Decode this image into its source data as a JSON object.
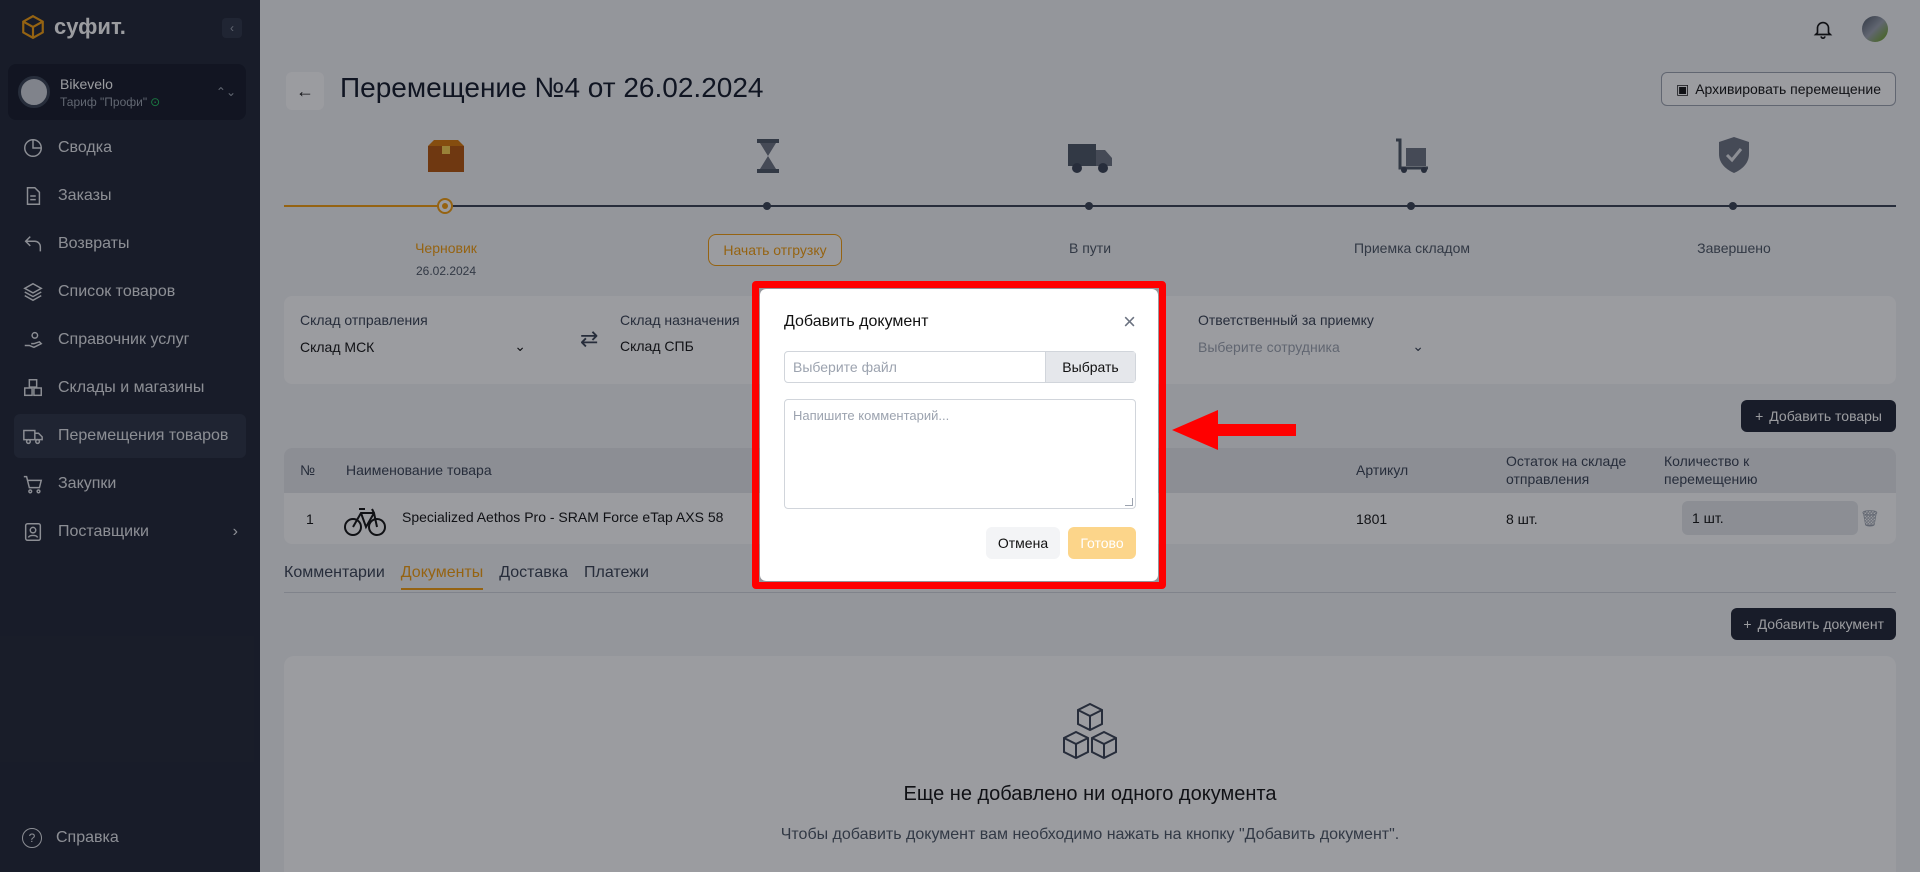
{
  "brand": {
    "name": "суфит."
  },
  "company": {
    "name": "Bikevelo",
    "tariff": "Тариф \"Профи\""
  },
  "nav": {
    "items": [
      {
        "label": "Сводка",
        "icon": "pie-chart-icon"
      },
      {
        "label": "Заказы",
        "icon": "document-icon"
      },
      {
        "label": "Возвраты",
        "icon": "return-icon"
      },
      {
        "label": "Список товаров",
        "icon": "layers-icon"
      },
      {
        "label": "Справочник услуг",
        "icon": "service-hand-icon"
      },
      {
        "label": "Склады и магазины",
        "icon": "boxes-icon"
      },
      {
        "label": "Перемещения товаров",
        "icon": "truck-icon"
      },
      {
        "label": "Закупки",
        "icon": "cart-icon"
      },
      {
        "label": "Поставщики",
        "icon": "contacts-icon"
      }
    ],
    "help": "Справка"
  },
  "page": {
    "title": "Перемещение №4 от 26.02.2024",
    "archive_button": "Архивировать перемещение"
  },
  "steps": [
    {
      "label": "Черновик",
      "date": "26.02.2024",
      "icon": "box-icon"
    },
    {
      "label": "Начать отгрузку",
      "icon": "hourglass-icon"
    },
    {
      "label": "В пути",
      "icon": "truck-icon"
    },
    {
      "label": "Приемка складом",
      "icon": "cart-dolly-icon"
    },
    {
      "label": "Завершено",
      "icon": "shield-check-icon"
    }
  ],
  "filters": {
    "from_label": "Склад отправления",
    "from_value": "Склад МСК",
    "to_label": "Склад назначения",
    "to_value": "Склад СПБ",
    "resp_label": "Ответственный за приемку",
    "resp_placeholder": "Выберите сотрудника"
  },
  "goods": {
    "add_button": "Добавить товары",
    "columns": [
      "№",
      "Наименование товара",
      "Артикул",
      "Остаток на складе отправления",
      "Количество к перемещению"
    ],
    "rows": [
      {
        "num": "1",
        "name": "Specialized Aethos Pro - SRAM Force eTap AXS 58",
        "article": "1801",
        "stock": "8 шт.",
        "qty": "1 шт."
      }
    ]
  },
  "tabs": [
    "Комментарии",
    "Документы",
    "Доставка",
    "Платежи"
  ],
  "documents": {
    "add_button": "Добавить документ",
    "empty_title": "Еще не добавлено ни одного документа",
    "empty_sub": "Чтобы добавить документ вам необходимо нажать на кнопку \"Добавить документ\"."
  },
  "modal": {
    "title": "Добавить документ",
    "file_placeholder": "Выберите файл",
    "choose_button": "Выбрать",
    "comment_placeholder": "Напишите комментарий...",
    "cancel_button": "Отмена",
    "done_button": "Готово"
  },
  "colors": {
    "accent": "#f59e0b",
    "sidebar": "#1e2433",
    "highlight": "#ff0000"
  }
}
